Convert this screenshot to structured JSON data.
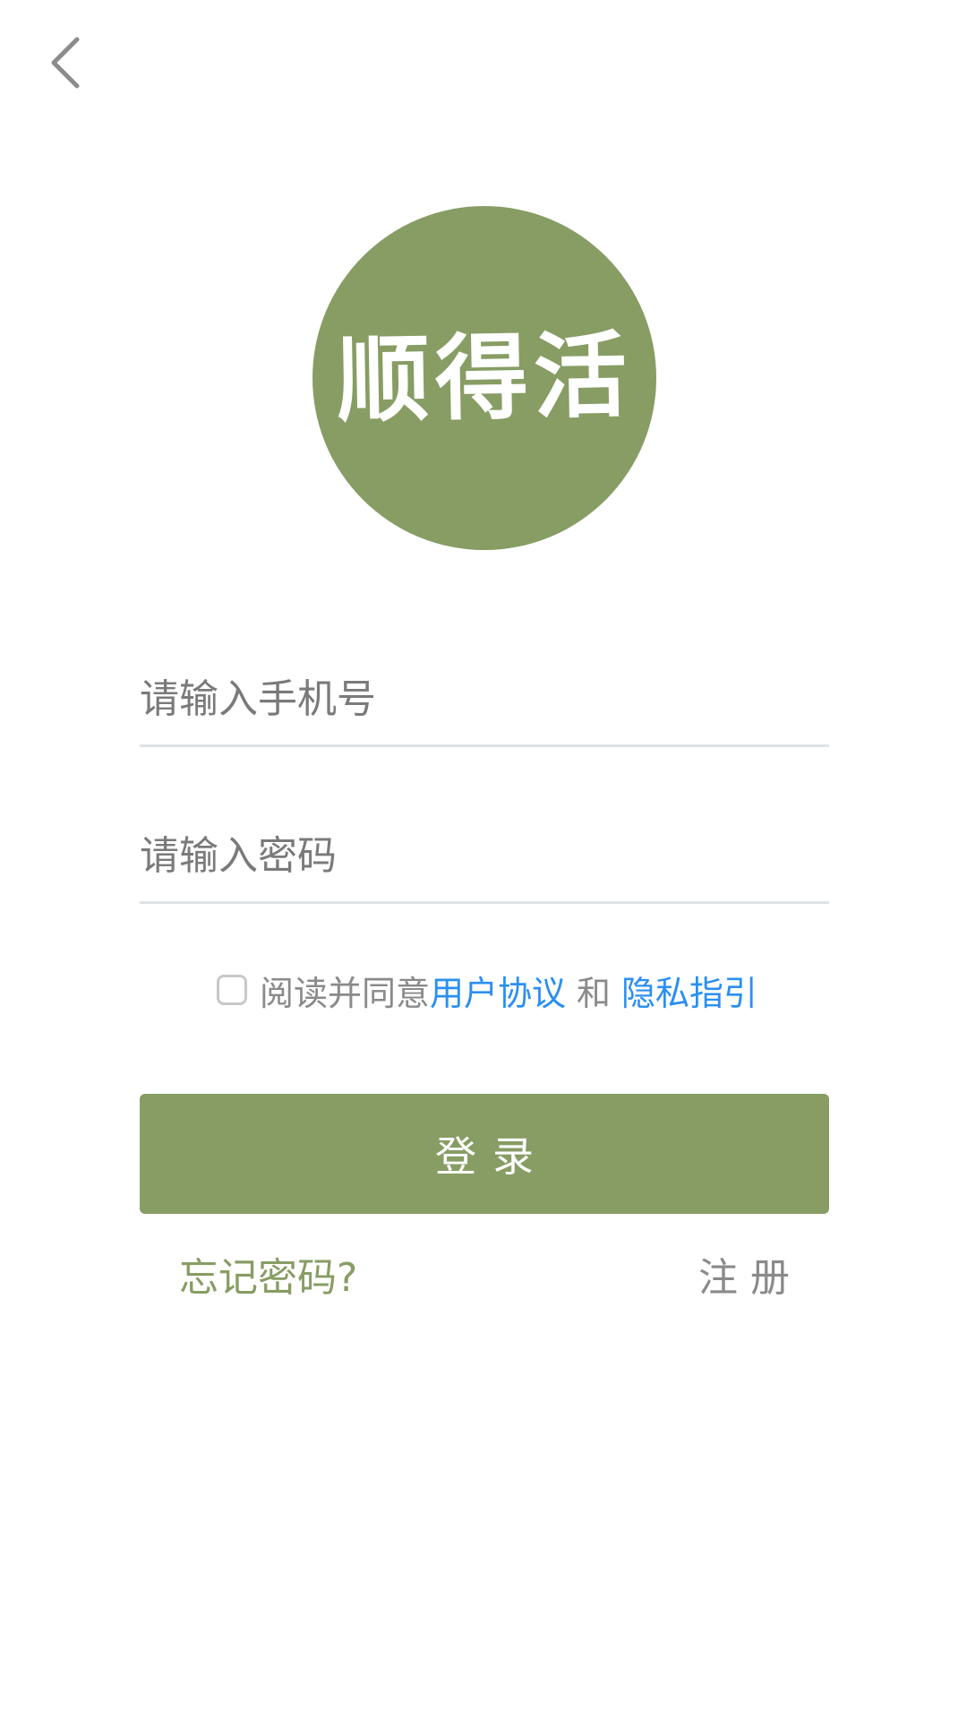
{
  "header": {
    "back_icon": "chevron-left-icon"
  },
  "logo": {
    "text": "顺得活",
    "color": "#879d64"
  },
  "form": {
    "phone_placeholder": "请输入手机号",
    "phone_value": "",
    "password_placeholder": "请输入密码",
    "password_value": ""
  },
  "agreement": {
    "checked": false,
    "prefix": "阅读并同意",
    "user_agreement": "用户协议",
    "and": "和",
    "privacy_policy": "隐私指引",
    "link_color": "#2b8ff0"
  },
  "actions": {
    "login_label": "登录",
    "forgot_label": "忘记密码?",
    "register_label": "注册",
    "accent_color": "#879d64"
  }
}
